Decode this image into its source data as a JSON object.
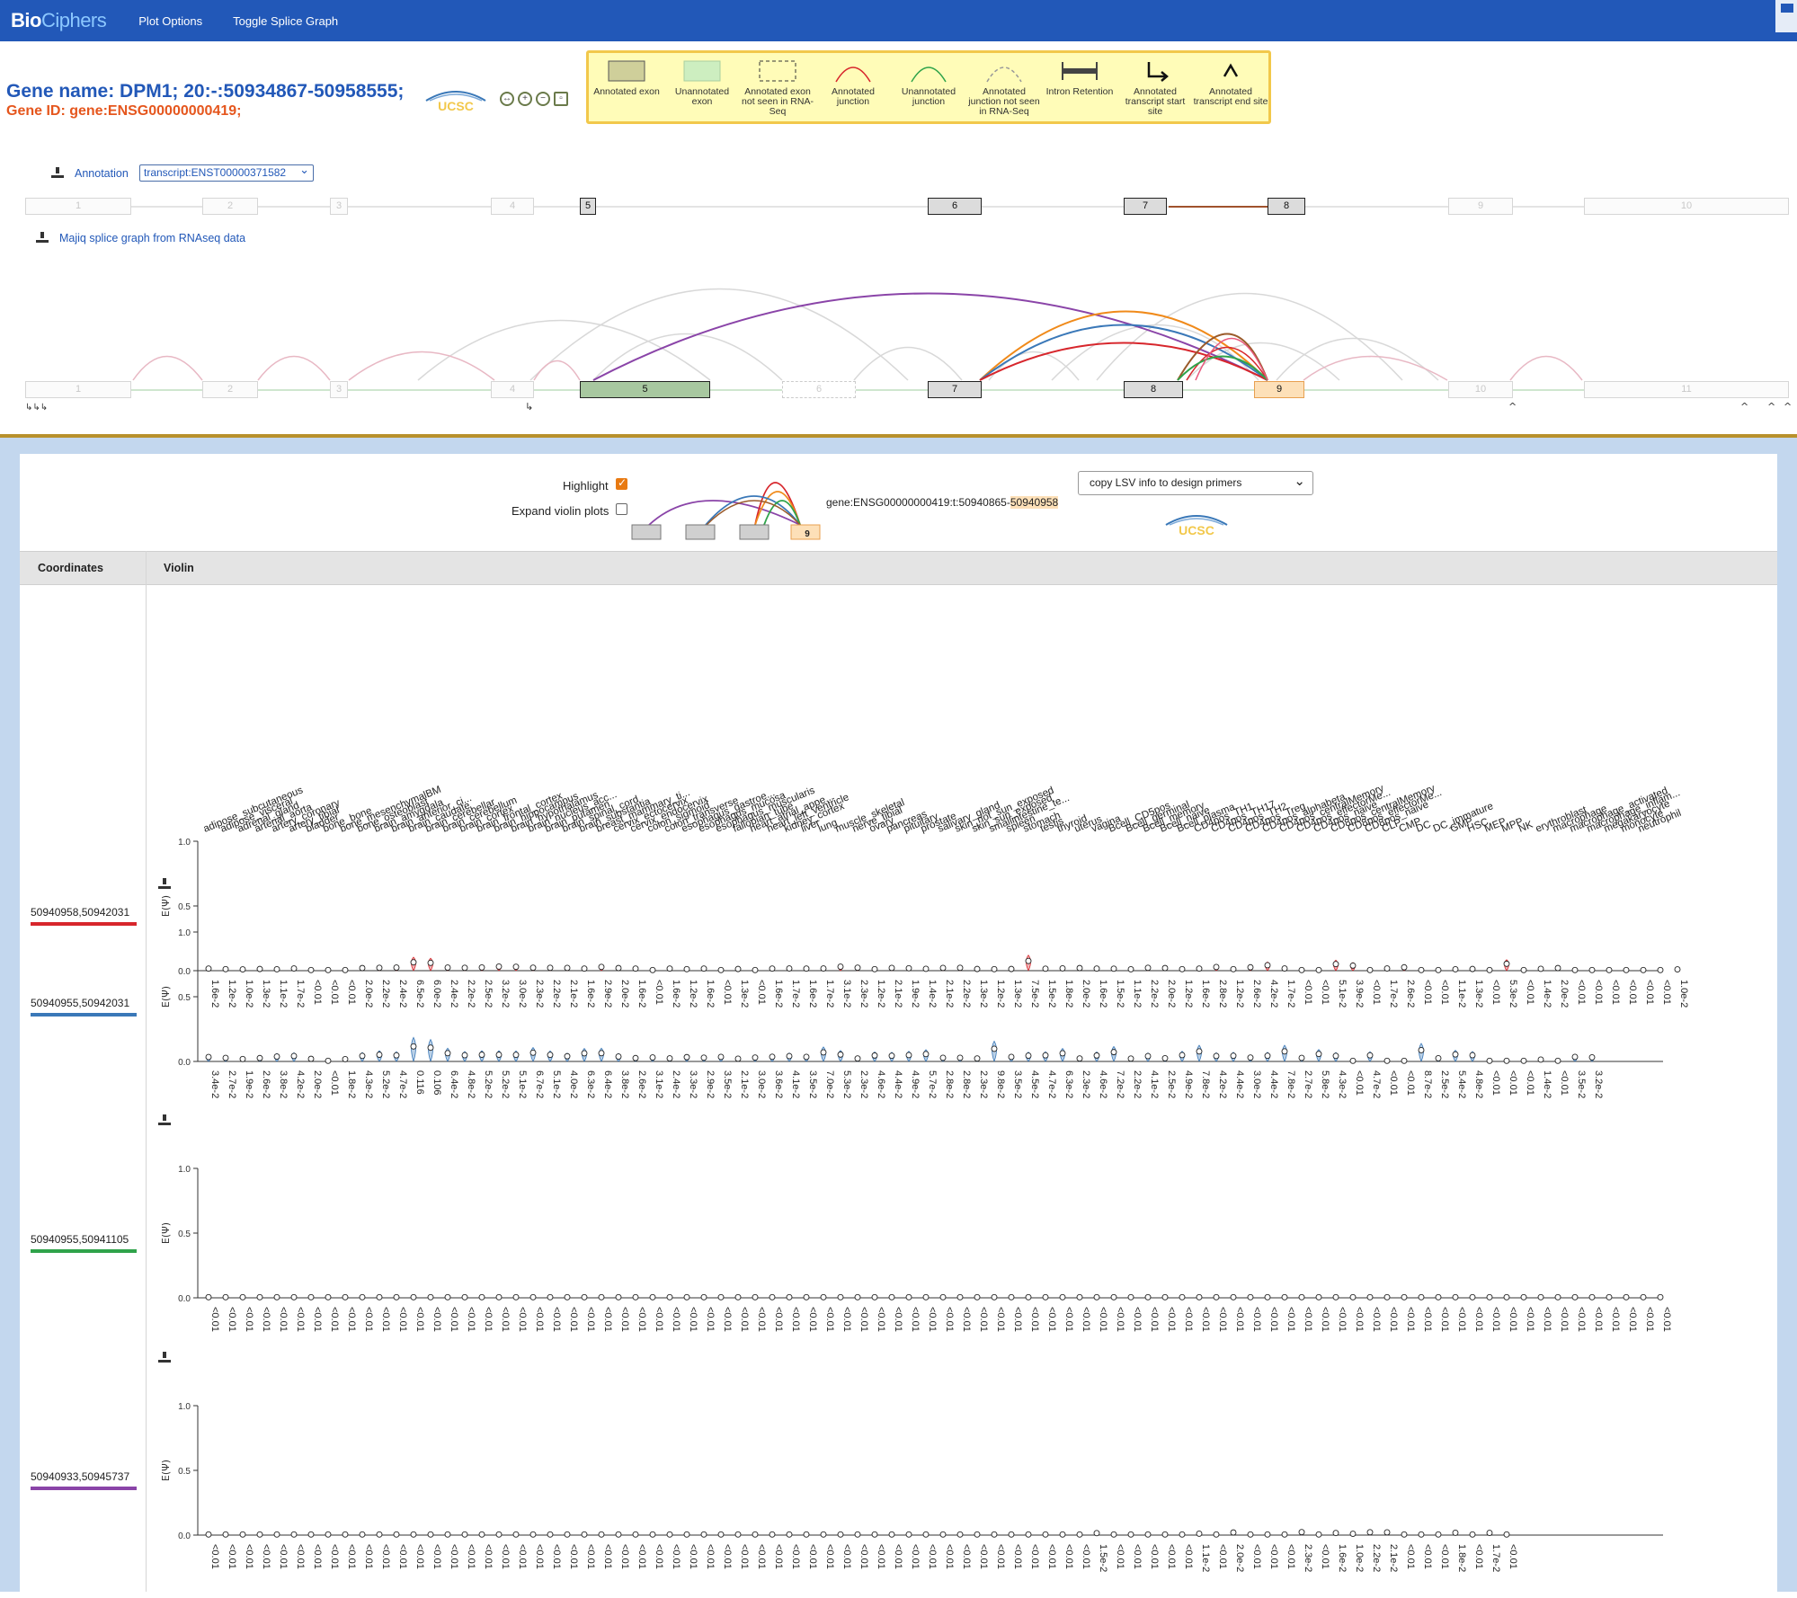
{
  "app": {
    "brand_bold": "Bio",
    "brand_light": "Ciphers"
  },
  "nav": {
    "plot_options": "Plot Options",
    "toggle_splice_graph": "Toggle Splice Graph"
  },
  "header": {
    "gene_name": "Gene name: DPM1; 20:-:50934867-50958555;",
    "gene_id": "Gene ID: gene:ENSG00000000419;",
    "ucsc": "UCSC"
  },
  "legend": [
    {
      "label": "Annotated exon",
      "type": "annot-exon"
    },
    {
      "label": "Unannotated exon",
      "type": "unannot-exon"
    },
    {
      "label": "Annotated exon not seen in RNA-Seq",
      "type": "unseen-exon"
    },
    {
      "label": "Annotated junction",
      "type": "annot-junc"
    },
    {
      "label": "Unannotated junction",
      "type": "unannot-junc"
    },
    {
      "label": "Annotated junction not seen in RNA-Seq",
      "type": "unseen-junc"
    },
    {
      "label": "Intron Retention",
      "type": "ir"
    },
    {
      "label": "Annotated transcript start site",
      "type": "tss"
    },
    {
      "label": "Annotated transcript end site",
      "type": "tes"
    }
  ],
  "annotation": {
    "label": "Annotation",
    "selected": "transcript:ENST00000371582"
  },
  "majiq_label": "Majiq splice graph from RNAseq data",
  "annotation_exons": [
    "1",
    "2",
    "3",
    "4",
    "5",
    "6",
    "7",
    "8",
    "9",
    "10"
  ],
  "majiq_exons": [
    "1",
    "2",
    "3",
    "4",
    "5",
    "6",
    "7",
    "8",
    "9",
    "10",
    "11"
  ],
  "lsv": {
    "highlight_label": "Highlight",
    "expand_label": "Expand violin plots",
    "mini_exon_label": "9",
    "id_prefix": "gene:ENSG00000000419:t:50940865-",
    "id_highlight": "50940958",
    "primer_select": "copy LSV info to design primers"
  },
  "table": {
    "col_coordinates": "Coordinates",
    "col_violin": "Violin"
  },
  "colors": {
    "red": "#d7262c",
    "blue": "#3a78b8",
    "green": "#2fa34a",
    "purple": "#8a44a8",
    "orange": "#f08a1a",
    "brown": "#9a5a2a"
  },
  "tissues": [
    "adipose_subcutaneous",
    "adipose_visceral",
    "adrenal_gland",
    "arterial_aorta",
    "artery_coronary",
    "artery_tibial",
    "bladder",
    "bone_bone",
    "bone_mesenchymalBM",
    "bone_osteoblast",
    "brain_amygdala",
    "brain_anterior_ci...",
    "brain_caudate",
    "brain_cerebellar",
    "brain_cerebellum",
    "brain_cortex",
    "brain_frontal_cortex",
    "brain_hippocampus",
    "brain_hypothalamus",
    "brain_nucleus_acc...",
    "brain_putamen",
    "brain_spinal_cord",
    "brain_substantia",
    "breast_mammary_ti...",
    "cervix_ectocervix",
    "cervix_endocervix",
    "colon_sigmoid",
    "colon_transverse",
    "esophagus_gastroe...",
    "esophagus_mucosa",
    "esophagus_muscularis",
    "fallopian_tube",
    "heart_atrial_appe...",
    "heart_left_ventricle",
    "kidney_cortex",
    "liver",
    "lung",
    "muscle_skeletal",
    "nerve_tibial",
    "ovary",
    "pancreas",
    "pituitary",
    "prostate",
    "salivary_gland",
    "skin_not_sun_exposed",
    "skin_sun_exposed",
    "smallintestine_te...",
    "spleen",
    "stomach",
    "testis",
    "thyroid",
    "uterus",
    "vagina",
    "Bcell_CD5pos",
    "Bcell_germinal",
    "Bcell_memory",
    "Bcell_naive",
    "Bcell_plasma",
    "CD4pos_TH1",
    "CD4pos_TH17",
    "CD4pos_TH2",
    "CD4pos_Treg",
    "CD4pos_alphabeta",
    "CD4pos_centralMemory",
    "CD4pos_effectorMe...",
    "CD4pos_naive",
    "CD8pos_centralMemory",
    "CD8pos_effectorMe...",
    "CD8pos_naive",
    "CLP",
    "CMP",
    "DC",
    "DC_immature",
    "GMP",
    "HSC",
    "MEP",
    "MPP",
    "NK",
    "erythroblast",
    "macrophage",
    "macrophage_activated",
    "macrophage_inflam...",
    "megakaryocyte",
    "monocyte",
    "neutrophil"
  ],
  "violin_rows": [
    {
      "coordinates": "50940958,50942031",
      "color": "#d7262c",
      "ylabel": "E(Ψ)",
      "yticks": [
        "1.0",
        "0.5",
        "0.0"
      ],
      "values": [
        "1.6e-2",
        "1.2e-2",
        "1.0e-2",
        "1.3e-2",
        "1.1e-2",
        "1.7e-2",
        "<0.01",
        "<0.01",
        "<0.01",
        "2.0e-2",
        "2.2e-2",
        "2.4e-2",
        "6.5e-2",
        "6.0e-2",
        "2.4e-2",
        "2.2e-2",
        "2.5e-2",
        "3.2e-2",
        "3.0e-2",
        "2.3e-2",
        "2.2e-2",
        "2.1e-2",
        "1.6e-2",
        "2.9e-2",
        "2.0e-2",
        "1.6e-2",
        "<0.01",
        "1.6e-2",
        "1.2e-2",
        "1.6e-2",
        "<0.01",
        "1.3e-2",
        "<0.01",
        "1.6e-2",
        "1.7e-2",
        "1.6e-2",
        "1.7e-2",
        "3.1e-2",
        "2.3e-2",
        "1.2e-2",
        "2.1e-2",
        "1.9e-2",
        "1.4e-2",
        "2.1e-2",
        "2.2e-2",
        "1.3e-2",
        "1.2e-2",
        "1.3e-2",
        "7.5e-2",
        "1.5e-2",
        "1.8e-2",
        "2.0e-2",
        "1.6e-2",
        "1.5e-2",
        "1.1e-2",
        "2.2e-2",
        "2.0e-2",
        "1.2e-2",
        "1.6e-2",
        "2.8e-2",
        "1.2e-2",
        "2.6e-2",
        "4.2e-2",
        "1.7e-2",
        "<0.01",
        "<0.01",
        "5.1e-2",
        "3.9e-2",
        "<0.01",
        "1.7e-2",
        "2.6e-2",
        "<0.01",
        "<0.01",
        "1.1e-2",
        "1.3e-2",
        "<0.01",
        "5.3e-2",
        "<0.01",
        "1.4e-2",
        "2.0e-2",
        "<0.01",
        "<0.01",
        "<0.01",
        "<0.01",
        "<0.01",
        "<0.01",
        "1.0e-2"
      ]
    },
    {
      "coordinates": "50940955,50942031",
      "color": "#3a78b8",
      "ylabel": "E(Ψ)",
      "yticks": [
        "1.0",
        "0.5",
        "0.0"
      ],
      "values": [
        "3.4e-2",
        "2.7e-2",
        "1.9e-2",
        "2.6e-2",
        "3.8e-2",
        "4.2e-2",
        "2.0e-2",
        "<0.01",
        "1.8e-2",
        "4.3e-2",
        "5.2e-2",
        "4.7e-2",
        "0.116",
        "0.106",
        "6.4e-2",
        "4.8e-2",
        "5.2e-2",
        "5.2e-2",
        "5.1e-2",
        "6.7e-2",
        "5.1e-2",
        "4.0e-2",
        "6.3e-2",
        "6.4e-2",
        "3.8e-2",
        "2.6e-2",
        "3.1e-2",
        "2.4e-2",
        "3.3e-2",
        "2.9e-2",
        "3.5e-2",
        "2.1e-2",
        "3.0e-2",
        "3.6e-2",
        "4.1e-2",
        "3.5e-2",
        "7.0e-2",
        "5.3e-2",
        "2.3e-2",
        "4.6e-2",
        "4.4e-2",
        "4.9e-2",
        "5.7e-2",
        "2.8e-2",
        "2.8e-2",
        "2.3e-2",
        "9.8e-2",
        "3.5e-2",
        "4.5e-2",
        "4.7e-2",
        "6.3e-2",
        "2.3e-2",
        "4.6e-2",
        "7.2e-2",
        "2.2e-2",
        "4.1e-2",
        "2.5e-2",
        "4.9e-2",
        "7.8e-2",
        "4.2e-2",
        "4.4e-2",
        "3.0e-2",
        "4.4e-2",
        "7.8e-2",
        "2.7e-2",
        "5.8e-2",
        "4.3e-2",
        "<0.01",
        "4.7e-2",
        "<0.01",
        "<0.01",
        "8.7e-2",
        "2.5e-2",
        "5.4e-2",
        "4.8e-2",
        "<0.01",
        "<0.01",
        "<0.01",
        "1.4e-2",
        "<0.01",
        "3.5e-2",
        "3.2e-2"
      ]
    },
    {
      "coordinates": "50940955,50941105",
      "color": "#2fa34a",
      "ylabel": "E(Ψ)",
      "yticks": [
        "1.0",
        "0.5",
        "0.0"
      ],
      "values": [
        "<0.01",
        "<0.01",
        "<0.01",
        "<0.01",
        "<0.01",
        "<0.01",
        "<0.01",
        "<0.01",
        "<0.01",
        "<0.01",
        "<0.01",
        "<0.01",
        "<0.01",
        "<0.01",
        "<0.01",
        "<0.01",
        "<0.01",
        "<0.01",
        "<0.01",
        "<0.01",
        "<0.01",
        "<0.01",
        "<0.01",
        "<0.01",
        "<0.01",
        "<0.01",
        "<0.01",
        "<0.01",
        "<0.01",
        "<0.01",
        "<0.01",
        "<0.01",
        "<0.01",
        "<0.01",
        "<0.01",
        "<0.01",
        "<0.01",
        "<0.01",
        "<0.01",
        "<0.01",
        "<0.01",
        "<0.01",
        "<0.01",
        "<0.01",
        "<0.01",
        "<0.01",
        "<0.01",
        "<0.01",
        "<0.01",
        "<0.01",
        "<0.01",
        "<0.01",
        "<0.01",
        "<0.01",
        "<0.01",
        "<0.01",
        "<0.01",
        "<0.01",
        "<0.01",
        "<0.01",
        "<0.01",
        "<0.01",
        "<0.01",
        "<0.01",
        "<0.01",
        "<0.01",
        "<0.01",
        "<0.01",
        "<0.01",
        "<0.01",
        "<0.01",
        "<0.01",
        "<0.01",
        "<0.01",
        "<0.01",
        "<0.01",
        "<0.01",
        "<0.01",
        "<0.01",
        "<0.01",
        "<0.01",
        "<0.01",
        "<0.01",
        "<0.01",
        "<0.01",
        "<0.01"
      ]
    },
    {
      "coordinates": "50940933,50945737",
      "color": "#8a44a8",
      "ylabel": "E(Ψ)",
      "yticks": [
        "1.0",
        "0.5",
        "0.0"
      ],
      "values": [
        "<0.01",
        "<0.01",
        "<0.01",
        "<0.01",
        "<0.01",
        "<0.01",
        "<0.01",
        "<0.01",
        "<0.01",
        "<0.01",
        "<0.01",
        "<0.01",
        "<0.01",
        "<0.01",
        "<0.01",
        "<0.01",
        "<0.01",
        "<0.01",
        "<0.01",
        "<0.01",
        "<0.01",
        "<0.01",
        "<0.01",
        "<0.01",
        "<0.01",
        "<0.01",
        "<0.01",
        "<0.01",
        "<0.01",
        "<0.01",
        "<0.01",
        "<0.01",
        "<0.01",
        "<0.01",
        "<0.01",
        "<0.01",
        "<0.01",
        "<0.01",
        "<0.01",
        "<0.01",
        "<0.01",
        "<0.01",
        "<0.01",
        "<0.01",
        "<0.01",
        "<0.01",
        "<0.01",
        "<0.01",
        "<0.01",
        "<0.01",
        "<0.01",
        "<0.01",
        "1.5e-2",
        "<0.01",
        "<0.01",
        "<0.01",
        "<0.01",
        "<0.01",
        "1.1e-2",
        "<0.01",
        "2.0e-2",
        "<0.01",
        "<0.01",
        "<0.01",
        "2.3e-2",
        "<0.01",
        "1.6e-2",
        "1.0e-2",
        "2.2e-2",
        "2.1e-2",
        "<0.01",
        "<0.01",
        "<0.01",
        "1.8e-2",
        "<0.01",
        "1.7e-2",
        "<0.01"
      ]
    }
  ]
}
